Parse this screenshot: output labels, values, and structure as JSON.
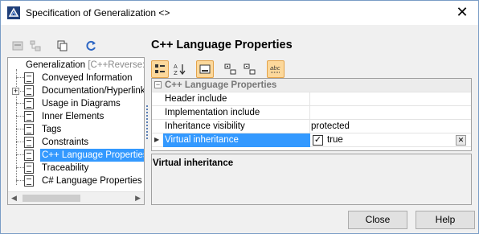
{
  "window": {
    "title": "Specification of Generalization <>"
  },
  "tree": {
    "items": [
      {
        "label": "Generalization",
        "suffix": " [C++Reverse::U"
      },
      {
        "label": "Conveyed Information"
      },
      {
        "label": "Documentation/Hyperlinks"
      },
      {
        "label": "Usage in Diagrams"
      },
      {
        "label": "Inner Elements"
      },
      {
        "label": "Tags"
      },
      {
        "label": "Constraints"
      },
      {
        "label": "C++ Language Properties"
      },
      {
        "label": "Traceability"
      },
      {
        "label": "C# Language Properties"
      }
    ],
    "selected_index": 7
  },
  "panel": {
    "title": "C++ Language Properties"
  },
  "properties": {
    "group": "C++ Language Properties",
    "rows": [
      {
        "name": "Header include",
        "value": ""
      },
      {
        "name": "Implementation include",
        "value": ""
      },
      {
        "name": "Inheritance visibility",
        "value": "protected"
      },
      {
        "name": "Virtual inheritance",
        "value": "true",
        "checked": true
      }
    ]
  },
  "description": {
    "title": "Virtual inheritance"
  },
  "buttons": {
    "close": "Close",
    "help": "Help"
  },
  "colors": {
    "selection": "#3399ff",
    "toggle_on": "#fcd89b",
    "accent_icon": "#2e67c4"
  }
}
